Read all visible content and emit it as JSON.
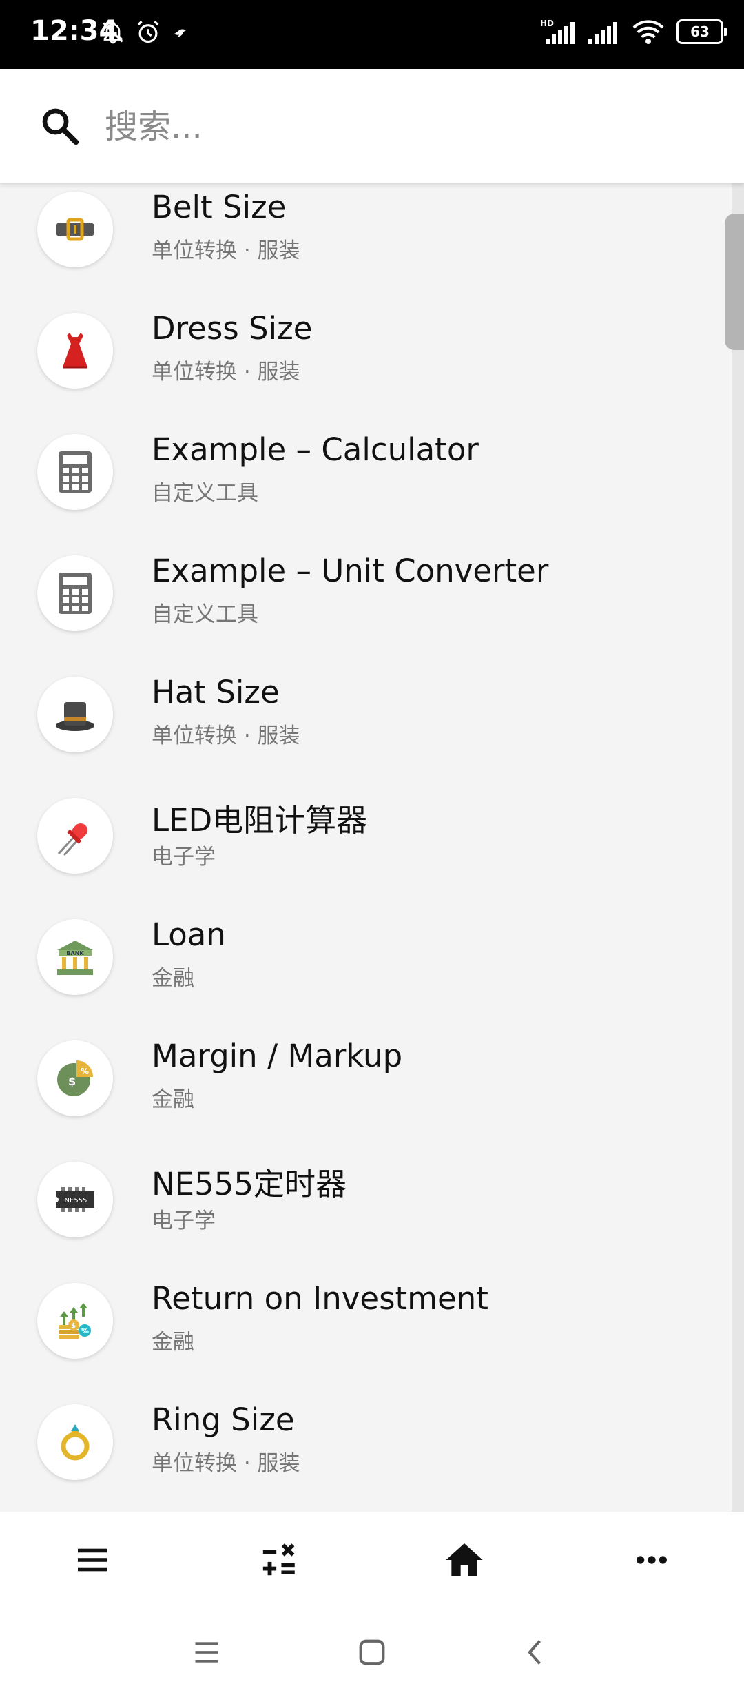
{
  "status_bar": {
    "time": "12:34",
    "battery": "63",
    "network": "HD"
  },
  "search": {
    "placeholder": "搜索..."
  },
  "items": [
    {
      "title": "Belt Size",
      "subtitle": "单位转换 · 服装",
      "icon": "belt-icon"
    },
    {
      "title": "Dress Size",
      "subtitle": "单位转换 · 服装",
      "icon": "dress-icon"
    },
    {
      "title": "Example – Calculator",
      "subtitle": "自定义工具",
      "icon": "calculator-icon"
    },
    {
      "title": "Example – Unit Converter",
      "subtitle": "自定义工具",
      "icon": "calculator-icon"
    },
    {
      "title": "Hat Size",
      "subtitle": "单位转换 · 服装",
      "icon": "top-hat-icon"
    },
    {
      "title": "LED电阻计算器",
      "subtitle": "电子学",
      "icon": "led-icon"
    },
    {
      "title": "Loan",
      "subtitle": "金融",
      "icon": "bank-icon"
    },
    {
      "title": "Margin / Markup",
      "subtitle": "金融",
      "icon": "pie-chart-icon"
    },
    {
      "title": "NE555定时器",
      "subtitle": "电子学",
      "icon": "chip-icon"
    },
    {
      "title": "Return on Investment",
      "subtitle": "金融",
      "icon": "investment-icon"
    },
    {
      "title": "Ring Size",
      "subtitle": "单位转换 · 服装",
      "icon": "ring-icon"
    }
  ],
  "chip_label": "NE555",
  "bank_label": "BANK",
  "bottom_nav": [
    "menu-icon",
    "calculator-ops-icon",
    "home-icon",
    "more-icon"
  ],
  "system_nav": [
    "recent-apps-icon",
    "home-square-icon",
    "back-icon"
  ]
}
